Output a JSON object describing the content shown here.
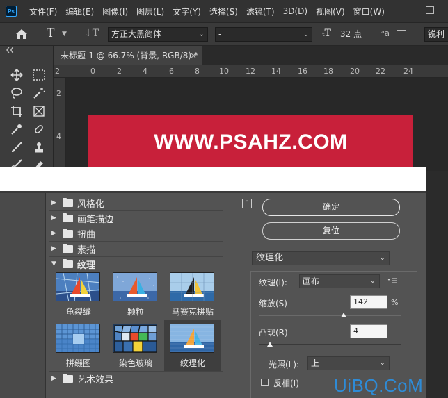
{
  "app": {
    "logo": "Ps"
  },
  "menu": [
    "文件(F)",
    "编辑(E)",
    "图像(I)",
    "图层(L)",
    "文字(Y)",
    "选择(S)",
    "滤镜(T)",
    "3D(D)",
    "视图(V)",
    "窗口(W)"
  ],
  "options": {
    "font_family": "方正大黑简体",
    "font_style": "-",
    "font_size": "32 点",
    "aa_mode": "锐利"
  },
  "document": {
    "tab_title": "未标题-1 @ 66.7% (背景, RGB/8) *",
    "ruler_top": [
      "2",
      "0",
      "2",
      "4",
      "6",
      "8",
      "10",
      "12",
      "14",
      "16",
      "18",
      "20",
      "22",
      "24"
    ],
    "ruler_left": [
      "2",
      "4"
    ],
    "banner_text": "WWW.PSAHZ.COM",
    "banner_color": "#c8203a"
  },
  "filter_gallery": {
    "categories": [
      {
        "label": "风格化",
        "open": false
      },
      {
        "label": "画笔描边",
        "open": false
      },
      {
        "label": "扭曲",
        "open": false
      },
      {
        "label": "素描",
        "open": false
      },
      {
        "label": "纹理",
        "open": true
      },
      {
        "label": "艺术效果",
        "open": false
      }
    ],
    "texture_filters": [
      {
        "label": "龟裂缝",
        "selected": false
      },
      {
        "label": "颗粒",
        "selected": false
      },
      {
        "label": "马赛克拼贴",
        "selected": false
      },
      {
        "label": "拼缀图",
        "selected": false
      },
      {
        "label": "染色玻璃",
        "selected": false
      },
      {
        "label": "纹理化",
        "selected": true
      }
    ],
    "ok_label": "确定",
    "reset_label": "复位",
    "selected_filter": "纹理化",
    "params": {
      "texture_label": "纹理(I):",
      "texture_value": "画布",
      "scale_label": "缩放(S)",
      "scale_value": "142",
      "scale_unit": "%",
      "scale_fraction": 0.6,
      "relief_label": "凸现(R)",
      "relief_value": "4",
      "relief_fraction": 0.08,
      "light_label": "光照(L):",
      "light_value": "上",
      "invert_label": "反相(I)",
      "invert_checked": false
    }
  },
  "watermark": "UiBQ.CoM",
  "colors": {
    "accent_blue": "#2e8bd6",
    "dialog_bg": "#535353"
  }
}
